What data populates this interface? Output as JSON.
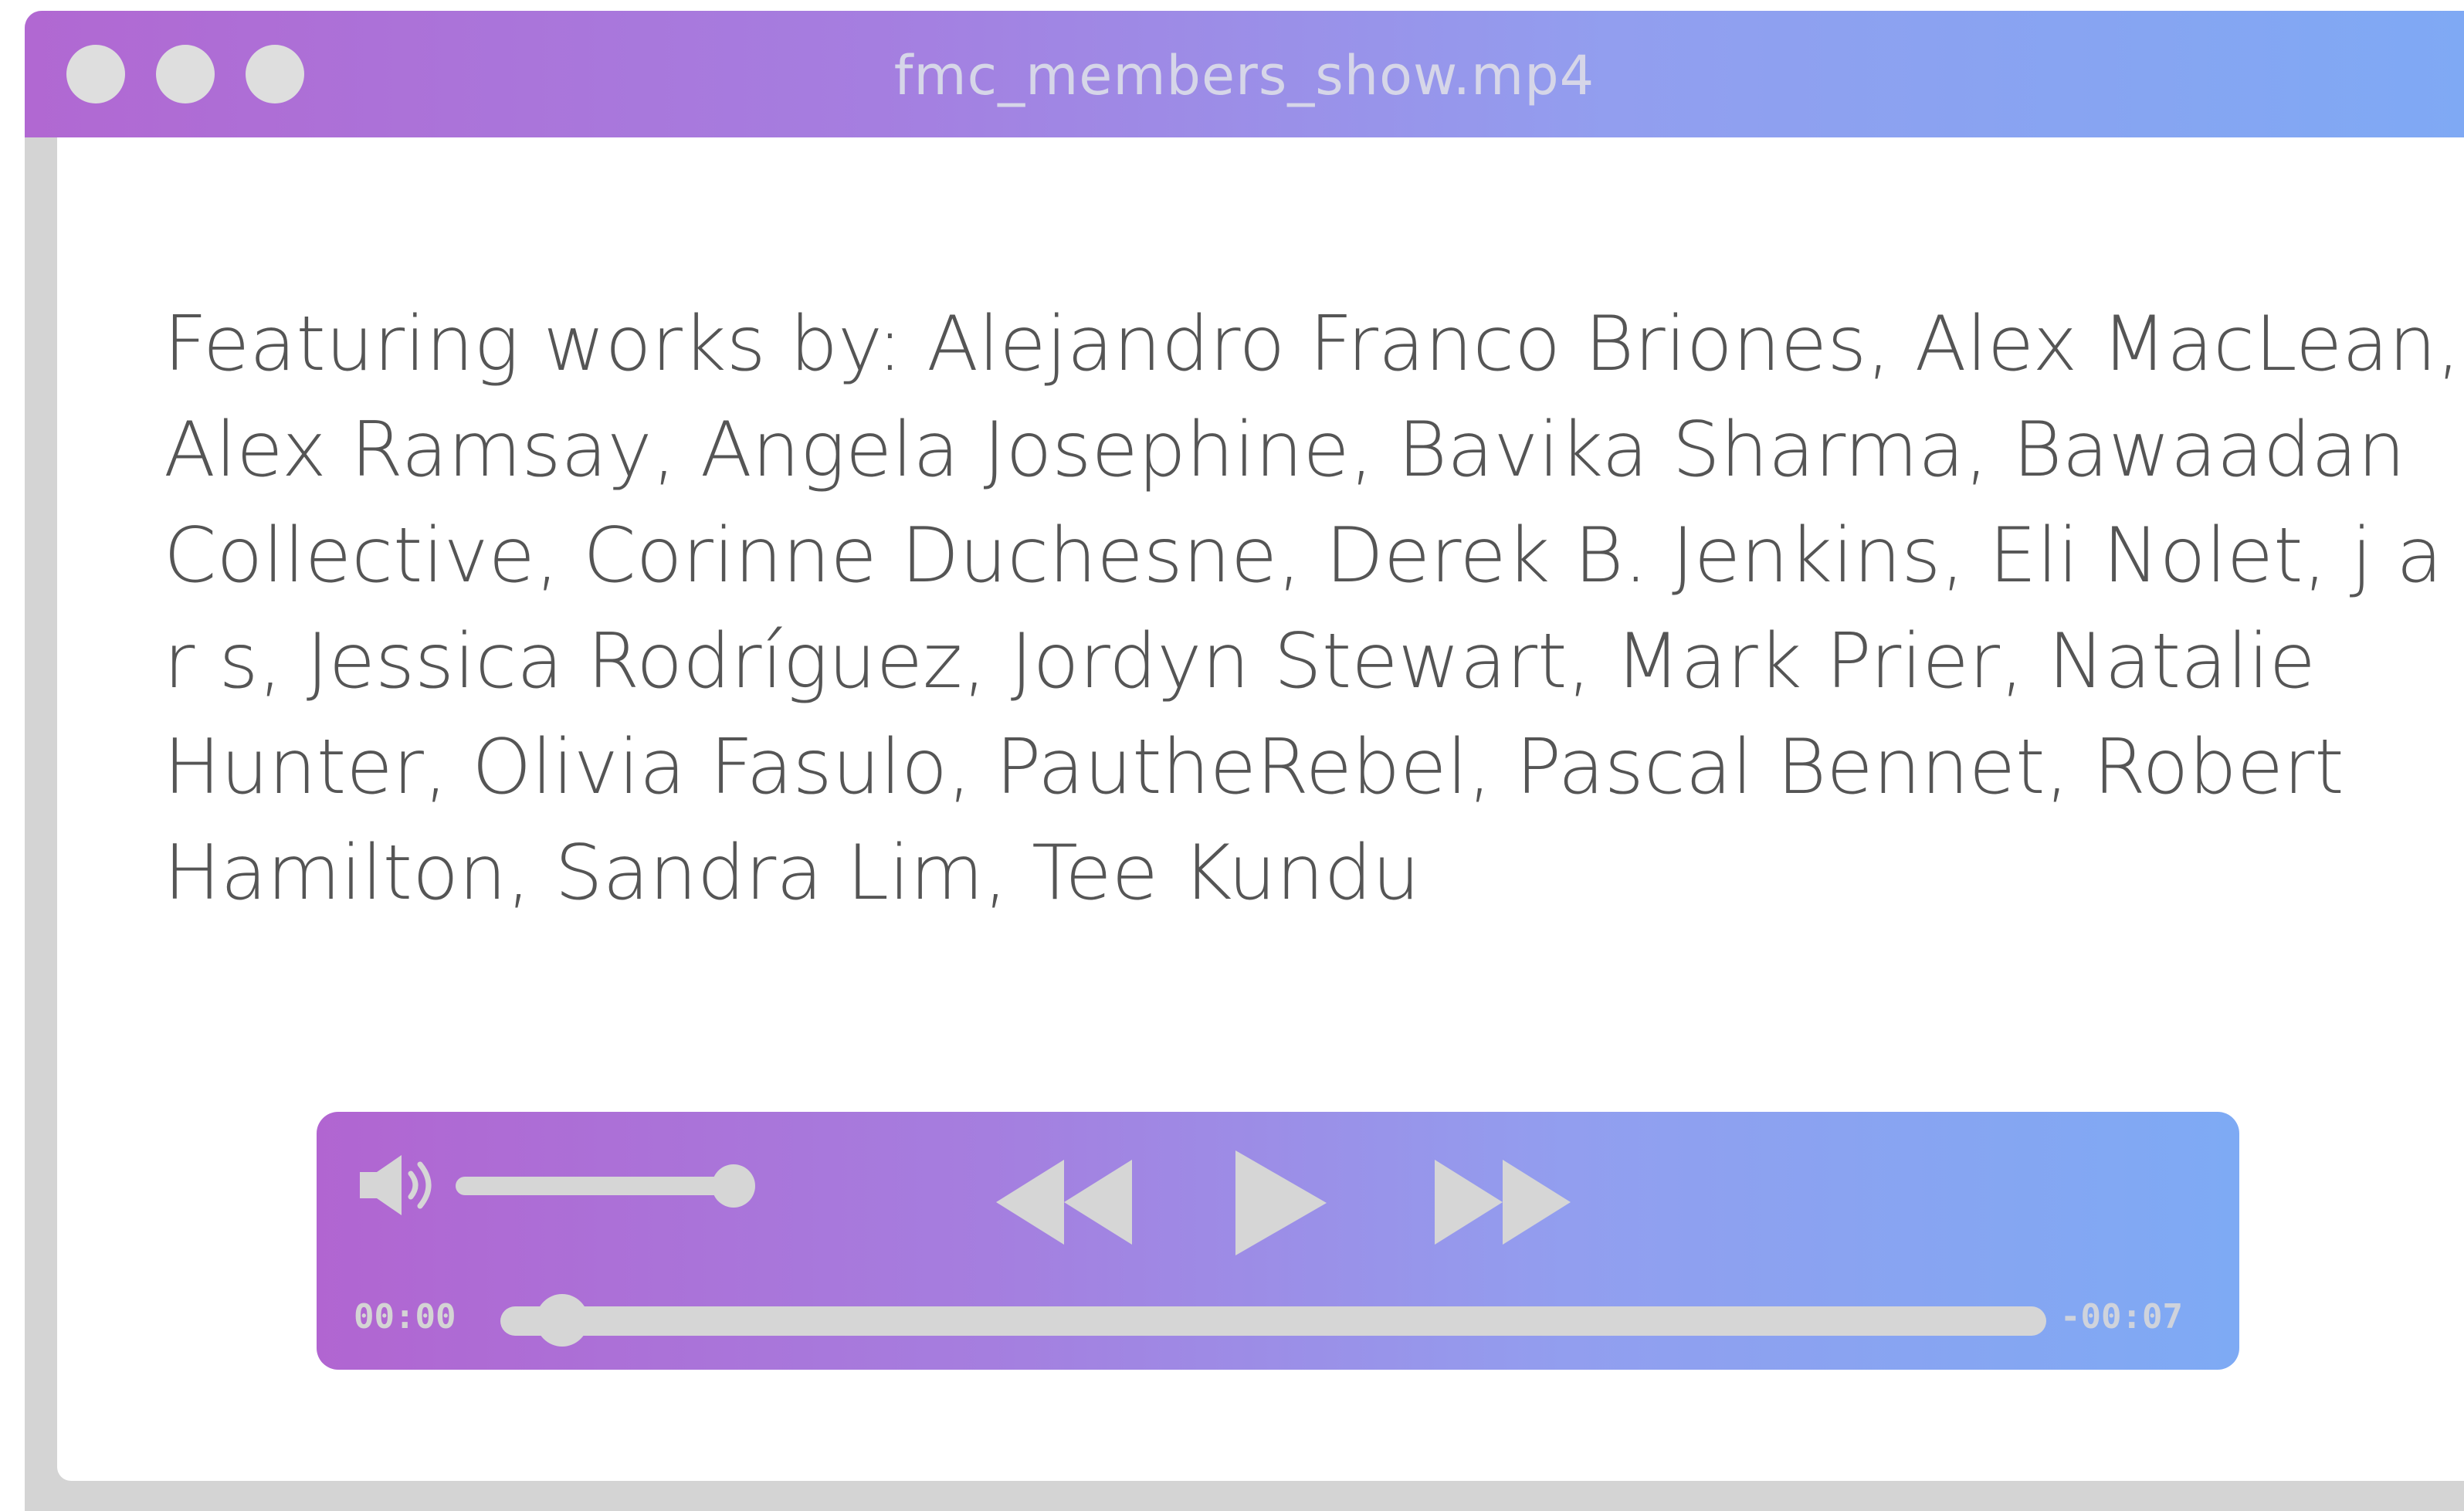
{
  "window": {
    "title": "fmc_members_show.mp4",
    "controls": [
      "close",
      "minimize",
      "zoom"
    ]
  },
  "content": {
    "credits_text": "Featuring works by: Alejandro Franco Briones, Alex MacLean, Alex Ramsay, Angela Josephine, Bavika Sharma, Bawaadan Collective, Corinne Duchesne, Derek B. Jenkins, Eli Nolet, j a r s, Jessica Rodríguez, Jordyn Stewart, Mark Prier, Natalie Hunter, Olivia Fasulo, PautheRebel, Pascal Bennet, Robert Hamilton, Sandra Lim, Tee Kundu"
  },
  "player": {
    "volume_icon": "speaker-icon",
    "volume_level": 1.0,
    "rewind_icon": "rewind-icon",
    "play_icon": "play-icon",
    "fast_forward_icon": "fast-forward-icon",
    "time_current": "00:00",
    "time_remaining": "-00:07",
    "progress": 0.02
  },
  "colors": {
    "gradient_start": "#b168d2",
    "gradient_end": "#7fa9f4",
    "control_gray": "#d6d6d6",
    "text_gray": "#555555",
    "frame_gray": "#d4d4d4"
  }
}
